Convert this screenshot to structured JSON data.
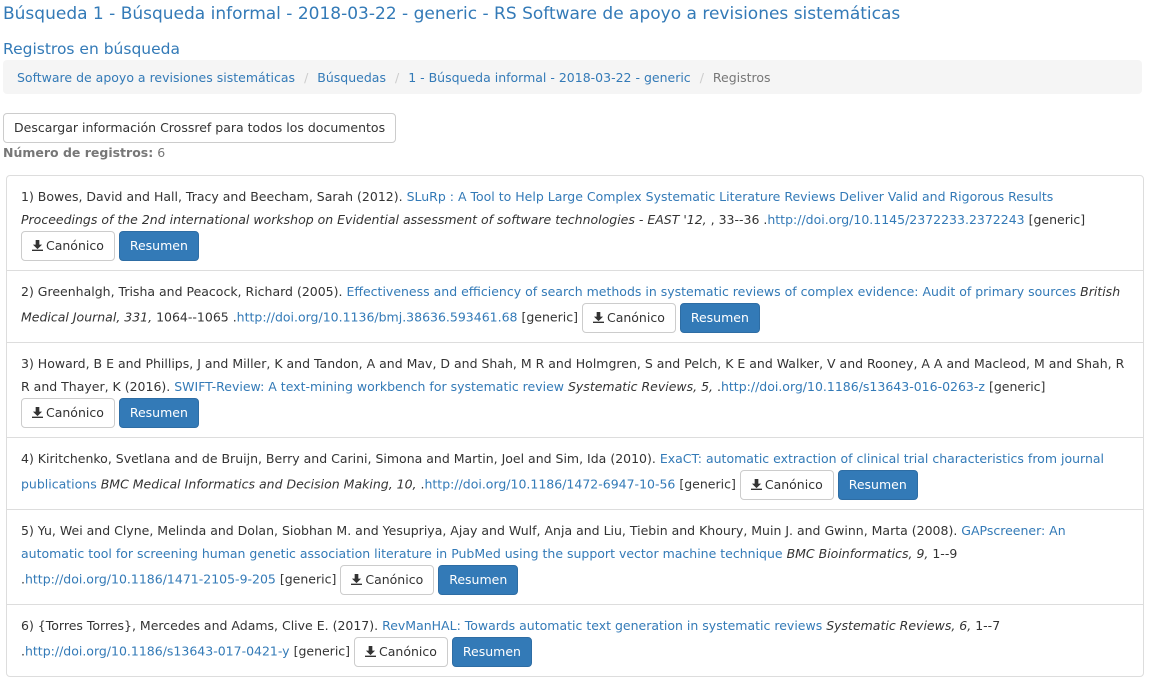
{
  "title": "Búsqueda 1 - Búsqueda informal - 2018-03-22 - generic - RS Software de apoyo a revisiones sistemáticas",
  "subtitle": "Registros en búsqueda",
  "breadcrumb": {
    "items": [
      "Software de apoyo a revisiones sistemáticas",
      "Búsquedas",
      "1 - Búsqueda informal - 2018-03-22 - generic"
    ],
    "active": "Registros",
    "separator": "/"
  },
  "crossref_button": "Descargar información Crossref para todos los documentos",
  "count_label": "Número de registros:",
  "count_value": "6",
  "labels": {
    "canonico": "Canónico",
    "resumen": "Resumen",
    "tag": "[generic]"
  },
  "records": [
    {
      "prefix": "1) Bowes, David and Hall, Tracy and Beecham, Sarah (2012). ",
      "title": "SLuRp : A Tool to Help Large Complex Systematic Literature Reviews Deliver Valid and Rigorous Results",
      "venue": " Proceedings of the 2nd international workshop on Evidential assessment of software technologies - EAST '12, ",
      "pages": ", 33--36 .",
      "doi": "http://doi.org/10.1145/2372233.2372243"
    },
    {
      "prefix": "2) Greenhalgh, Trisha and Peacock, Richard (2005). ",
      "title": "Effectiveness and efficiency of search methods in systematic reviews of complex evidence: Audit of primary sources",
      "venue": " British Medical Journal, 331, ",
      "pages": "1064--1065 .",
      "doi": "http://doi.org/10.1136/bmj.38636.593461.68"
    },
    {
      "prefix": "3) Howard, B E and Phillips, J and Miller, K and Tandon, A and Mav, D and Shah, M R and Holmgren, S and Pelch, K E and Walker, V and Rooney, A A and Macleod, M and Shah, R R and Thayer, K (2016). ",
      "title": "SWIFT-Review: A text-mining workbench for systematic review",
      "venue": " Systematic Reviews, 5, ",
      "pages": ".",
      "doi": "http://doi.org/10.1186/s13643-016-0263-z"
    },
    {
      "prefix": "4) Kiritchenko, Svetlana and de Bruijn, Berry and Carini, Simona and Martin, Joel and Sim, Ida (2010). ",
      "title": "ExaCT: automatic extraction of clinical trial characteristics from journal publications",
      "venue": " BMC Medical Informatics and Decision Making, 10, ",
      "pages": ".",
      "doi": "http://doi.org/10.1186/1472-6947-10-56"
    },
    {
      "prefix": "5) Yu, Wei and Clyne, Melinda and Dolan, Siobhan M. and Yesupriya, Ajay and Wulf, Anja and Liu, Tiebin and Khoury, Muin J. and Gwinn, Marta (2008). ",
      "title": "GAPscreener: An automatic tool for screening human genetic association literature in PubMed using the support vector machine technique",
      "venue": " BMC Bioinformatics, 9, ",
      "pages": "1--9 .",
      "doi": "http://doi.org/10.1186/1471-2105-9-205"
    },
    {
      "prefix": "6) {Torres Torres}, Mercedes and Adams, Clive E. (2017). ",
      "title": "RevManHAL: Towards automatic text generation in systematic reviews",
      "venue": " Systematic Reviews, 6, ",
      "pages": "1--7 .",
      "doi": "http://doi.org/10.1186/s13643-017-0421-y"
    }
  ]
}
